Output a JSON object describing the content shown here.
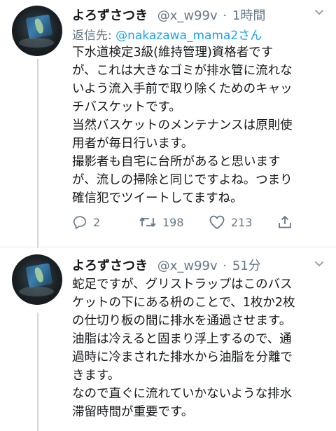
{
  "tweets": [
    {
      "name": "よろずさつき",
      "handle": "@x_w99v",
      "time": "1時間",
      "reply_label": "返信先: ",
      "reply_handle": "@nakazawa_mama2さん",
      "lines": [
        "下水道検定3級(維持管理)資格者です",
        "が、これは大きなゴミが排水管に流れな",
        "いよう流入手前で取り除くためのキャッ",
        "チバスケットです。",
        "当然バスケットのメンテナンスは原則使",
        "用者が毎日行います。",
        "撮影者も自宅に台所があると思います",
        "が、流しの掃除と同じですよね。つまり",
        "確信犯でツイートしてますね。"
      ],
      "reply_count": "2",
      "retweet_count": "198",
      "like_count": "213"
    },
    {
      "name": "よろずさつき",
      "handle": "@x_w99v",
      "time": "51分",
      "lines": [
        "蛇足ですが、グリストラップはこのバス",
        "ケットの下にある枡のことで、1枚か2枚",
        "の仕切り板の間に排水を通過させます。",
        "油脂は冷えると固まり浮上するので、通",
        "過時に冷まされた排水から油脂を分離で",
        "きます。",
        "なので直ぐに流れていかないような排水",
        "滞留時間が重要です。"
      ]
    }
  ],
  "separator": "·",
  "colors": {
    "link": "#1da1f2",
    "muted": "#657786",
    "text": "#14171a"
  }
}
